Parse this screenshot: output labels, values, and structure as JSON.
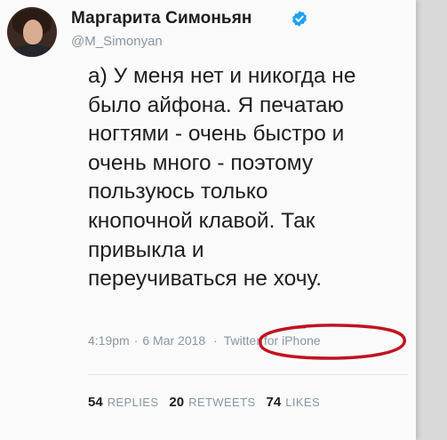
{
  "author": {
    "name": "Маргарита Симоньян",
    "handle": "@M_Simonyan",
    "verified": true
  },
  "tweet": {
    "lines": [
      "а) У меня нет и никогда не",
      "было айфона. Я печатаю",
      "ногтями - очень быстро и",
      "очень много - поэтому",
      "пользуюсь только",
      "кнопочной клавой. Так",
      "привыкла и",
      "переучиваться не хочу."
    ],
    "time": "4:19pm",
    "separator": "·",
    "date": "6 Mar 2018",
    "source": "Twitter for iPhone"
  },
  "stats": {
    "replies_count": "54",
    "replies_label": "REPLIES",
    "retweets_count": "20",
    "retweets_label": "RETWEETS",
    "likes_count": "74",
    "likes_label": "LIKES"
  },
  "colors": {
    "verified_badge": "#1da1f2",
    "highlight_circle": "#c1121f",
    "muted_text": "#8a96a0"
  },
  "icons": {
    "verified": "verified-badge-icon"
  }
}
